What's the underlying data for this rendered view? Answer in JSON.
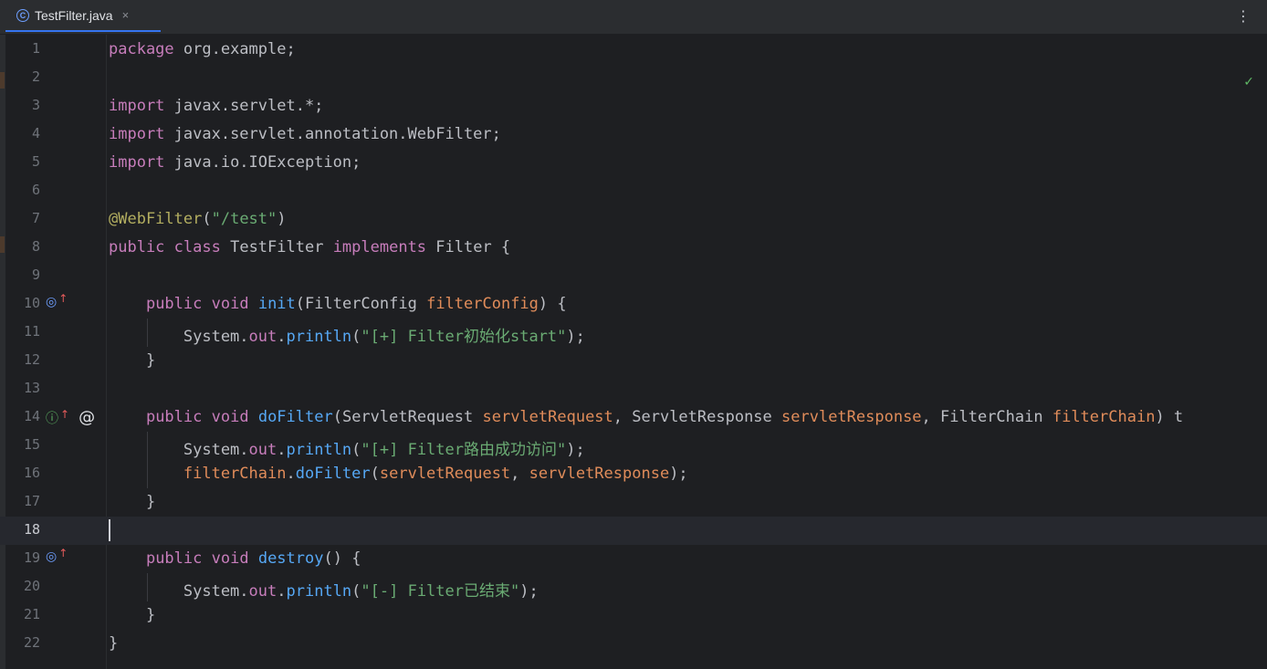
{
  "tab": {
    "icon": "class-icon",
    "label": "TestFilter.java",
    "close": "×"
  },
  "menu": "⋮",
  "status": "✓",
  "lines": [
    {
      "num": "1",
      "code": [
        [
          "kw2",
          "package"
        ],
        [
          "plain",
          " org.example;"
        ]
      ]
    },
    {
      "num": "2",
      "code": []
    },
    {
      "num": "3",
      "code": [
        [
          "kw2",
          "import"
        ],
        [
          "plain",
          " javax.servlet.*;"
        ]
      ]
    },
    {
      "num": "4",
      "code": [
        [
          "kw2",
          "import"
        ],
        [
          "plain",
          " javax.servlet.annotation.WebFilter;"
        ]
      ]
    },
    {
      "num": "5",
      "code": [
        [
          "kw2",
          "import"
        ],
        [
          "plain",
          " java.io.IOException;"
        ]
      ]
    },
    {
      "num": "6",
      "code": []
    },
    {
      "num": "7",
      "code": [
        [
          "ann",
          "@WebFilter"
        ],
        [
          "plain",
          "("
        ],
        [
          "str",
          "\"/test\""
        ],
        [
          "plain",
          ")"
        ]
      ]
    },
    {
      "num": "8",
      "code": [
        [
          "kw2",
          "public"
        ],
        [
          "plain",
          " "
        ],
        [
          "kw2",
          "class"
        ],
        [
          "plain",
          " TestFilter "
        ],
        [
          "kw2",
          "implements"
        ],
        [
          "plain",
          " Filter {"
        ]
      ]
    },
    {
      "num": "9",
      "code": []
    },
    {
      "num": "10",
      "gutter": [
        "o",
        "up"
      ],
      "code": [
        [
          "plain",
          "    "
        ],
        [
          "kw2",
          "public"
        ],
        [
          "plain",
          " "
        ],
        [
          "kw2",
          "void"
        ],
        [
          "plain",
          " "
        ],
        [
          "fn",
          "init"
        ],
        [
          "plain",
          "(FilterConfig "
        ],
        [
          "param",
          "filterConfig"
        ],
        [
          "plain",
          ") {"
        ]
      ]
    },
    {
      "num": "11",
      "code": [
        [
          "plain",
          "        System."
        ],
        [
          "field",
          "out"
        ],
        [
          "plain",
          "."
        ],
        [
          "fn",
          "println"
        ],
        [
          "plain",
          "("
        ],
        [
          "str",
          "\"[+] Filter初始化start\""
        ],
        [
          "plain",
          ");"
        ]
      ]
    },
    {
      "num": "12",
      "code": [
        [
          "plain",
          "    }"
        ]
      ]
    },
    {
      "num": "13",
      "code": []
    },
    {
      "num": "14",
      "gutter": [
        "i",
        "up",
        "at"
      ],
      "code": [
        [
          "plain",
          "    "
        ],
        [
          "kw2",
          "public"
        ],
        [
          "plain",
          " "
        ],
        [
          "kw2",
          "void"
        ],
        [
          "plain",
          " "
        ],
        [
          "fn",
          "doFilter"
        ],
        [
          "plain",
          "(ServletRequest "
        ],
        [
          "param",
          "servletRequest"
        ],
        [
          "plain",
          ", ServletResponse "
        ],
        [
          "param",
          "servletResponse"
        ],
        [
          "plain",
          ", FilterChain "
        ],
        [
          "param",
          "filterChain"
        ],
        [
          "plain",
          ") t"
        ]
      ]
    },
    {
      "num": "15",
      "code": [
        [
          "plain",
          "        System."
        ],
        [
          "field",
          "out"
        ],
        [
          "plain",
          "."
        ],
        [
          "fn",
          "println"
        ],
        [
          "plain",
          "("
        ],
        [
          "str",
          "\"[+] Filter路由成功访问\""
        ],
        [
          "plain",
          ");"
        ]
      ]
    },
    {
      "num": "16",
      "code": [
        [
          "plain",
          "        "
        ],
        [
          "param",
          "filterChain"
        ],
        [
          "plain",
          "."
        ],
        [
          "fn",
          "doFilter"
        ],
        [
          "plain",
          "("
        ],
        [
          "param",
          "servletRequest"
        ],
        [
          "plain",
          ", "
        ],
        [
          "param",
          "servletResponse"
        ],
        [
          "plain",
          ");"
        ]
      ]
    },
    {
      "num": "17",
      "code": [
        [
          "plain",
          "    }"
        ]
      ]
    },
    {
      "num": "18",
      "current": true,
      "code": []
    },
    {
      "num": "19",
      "gutter": [
        "o",
        "up"
      ],
      "code": [
        [
          "plain",
          "    "
        ],
        [
          "kw2",
          "public"
        ],
        [
          "plain",
          " "
        ],
        [
          "kw2",
          "void"
        ],
        [
          "plain",
          " "
        ],
        [
          "fn",
          "destroy"
        ],
        [
          "plain",
          "() {"
        ]
      ]
    },
    {
      "num": "20",
      "code": [
        [
          "plain",
          "        System."
        ],
        [
          "field",
          "out"
        ],
        [
          "plain",
          "."
        ],
        [
          "fn",
          "println"
        ],
        [
          "plain",
          "("
        ],
        [
          "str",
          "\"[-] Filter已结束\""
        ],
        [
          "plain",
          ");"
        ]
      ]
    },
    {
      "num": "21",
      "code": [
        [
          "plain",
          "    }"
        ]
      ]
    },
    {
      "num": "22",
      "code": [
        [
          "plain",
          "}"
        ]
      ]
    }
  ]
}
